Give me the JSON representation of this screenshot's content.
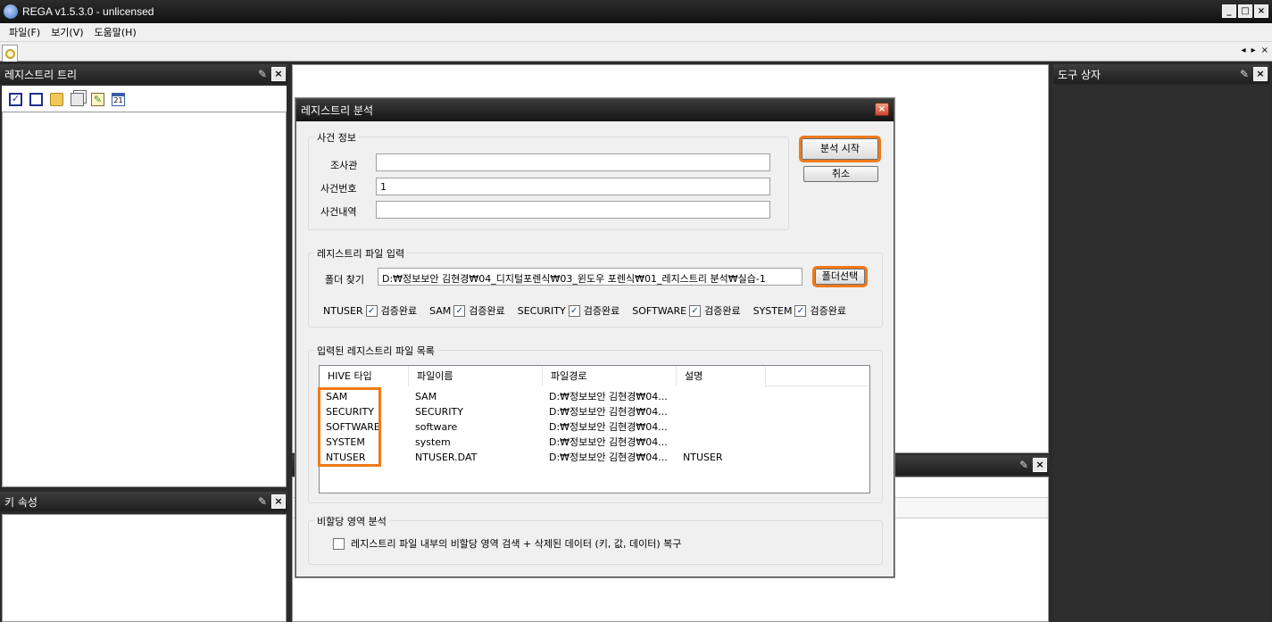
{
  "app": {
    "title": "REGA v1.5.3.0 - unlicensed"
  },
  "menu": [
    "파일(F)",
    "보기(V)",
    "도움말(H)"
  ],
  "window_buttons": [
    "_",
    "□",
    "×"
  ],
  "tab_nav": [
    "◂",
    "▸",
    "×"
  ],
  "panes": {
    "registry_tree": "레지스트리 트리",
    "key_props": "키 속성",
    "toolbox": "도구 상자"
  },
  "tree_toolbar": {
    "calendar_text": "21"
  },
  "dialog": {
    "title": "레지스트리 분석",
    "close": "×",
    "case_info": {
      "group_title": "사건 정보",
      "investigator_label": "조사관",
      "investigator_value": "",
      "case_no_label": "사건번호",
      "case_no_value": "1",
      "case_desc_label": "사건내역",
      "case_desc_value": ""
    },
    "start_button": "분석 시작",
    "cancel_button": "취소",
    "file_input": {
      "group_title": "레지스트리 파일 입력",
      "folder_label": "폴더 찾기",
      "folder_value": "D:₩정보보안 김현경₩04_디지털포렌식₩03_윈도우 포렌식₩01_레지스트리 분석₩실습-1",
      "folder_button": "폴더선택",
      "verified_text": "검증완료",
      "hives": [
        {
          "name": "NTUSER",
          "checked": true
        },
        {
          "name": "SAM",
          "checked": true
        },
        {
          "name": "SECURITY",
          "checked": true
        },
        {
          "name": "SOFTWARE",
          "checked": true
        },
        {
          "name": "SYSTEM",
          "checked": true
        }
      ]
    },
    "file_list": {
      "group_title": "입력된 레지스트리 파일 목록",
      "columns": [
        "HIVE 타입",
        "파일이름",
        "파일경로",
        "설명"
      ],
      "rows": [
        [
          "SAM",
          "SAM",
          "D:₩정보보안 김현경₩04...",
          ""
        ],
        [
          "SECURITY",
          "SECURITY",
          "D:₩정보보안 김현경₩04...",
          ""
        ],
        [
          "SOFTWARE",
          "software",
          "D:₩정보보안 김현경₩04...",
          ""
        ],
        [
          "SYSTEM",
          "system",
          "D:₩정보보안 김현경₩04...",
          ""
        ],
        [
          "NTUSER",
          "NTUSER.DAT",
          "D:₩정보보안 김현경₩04...",
          "NTUSER"
        ]
      ]
    },
    "unalloc": {
      "group_title": "비할당 영역 분석",
      "checkbox_label": "레지스트리 파일 내부의 비할당 영역 검색 + 삭제된 데이터 (키, 값, 데이터) 복구",
      "checked": false
    }
  },
  "colors": {
    "highlight": "#f07a1a",
    "dark_bg": "#2b2b2b"
  }
}
